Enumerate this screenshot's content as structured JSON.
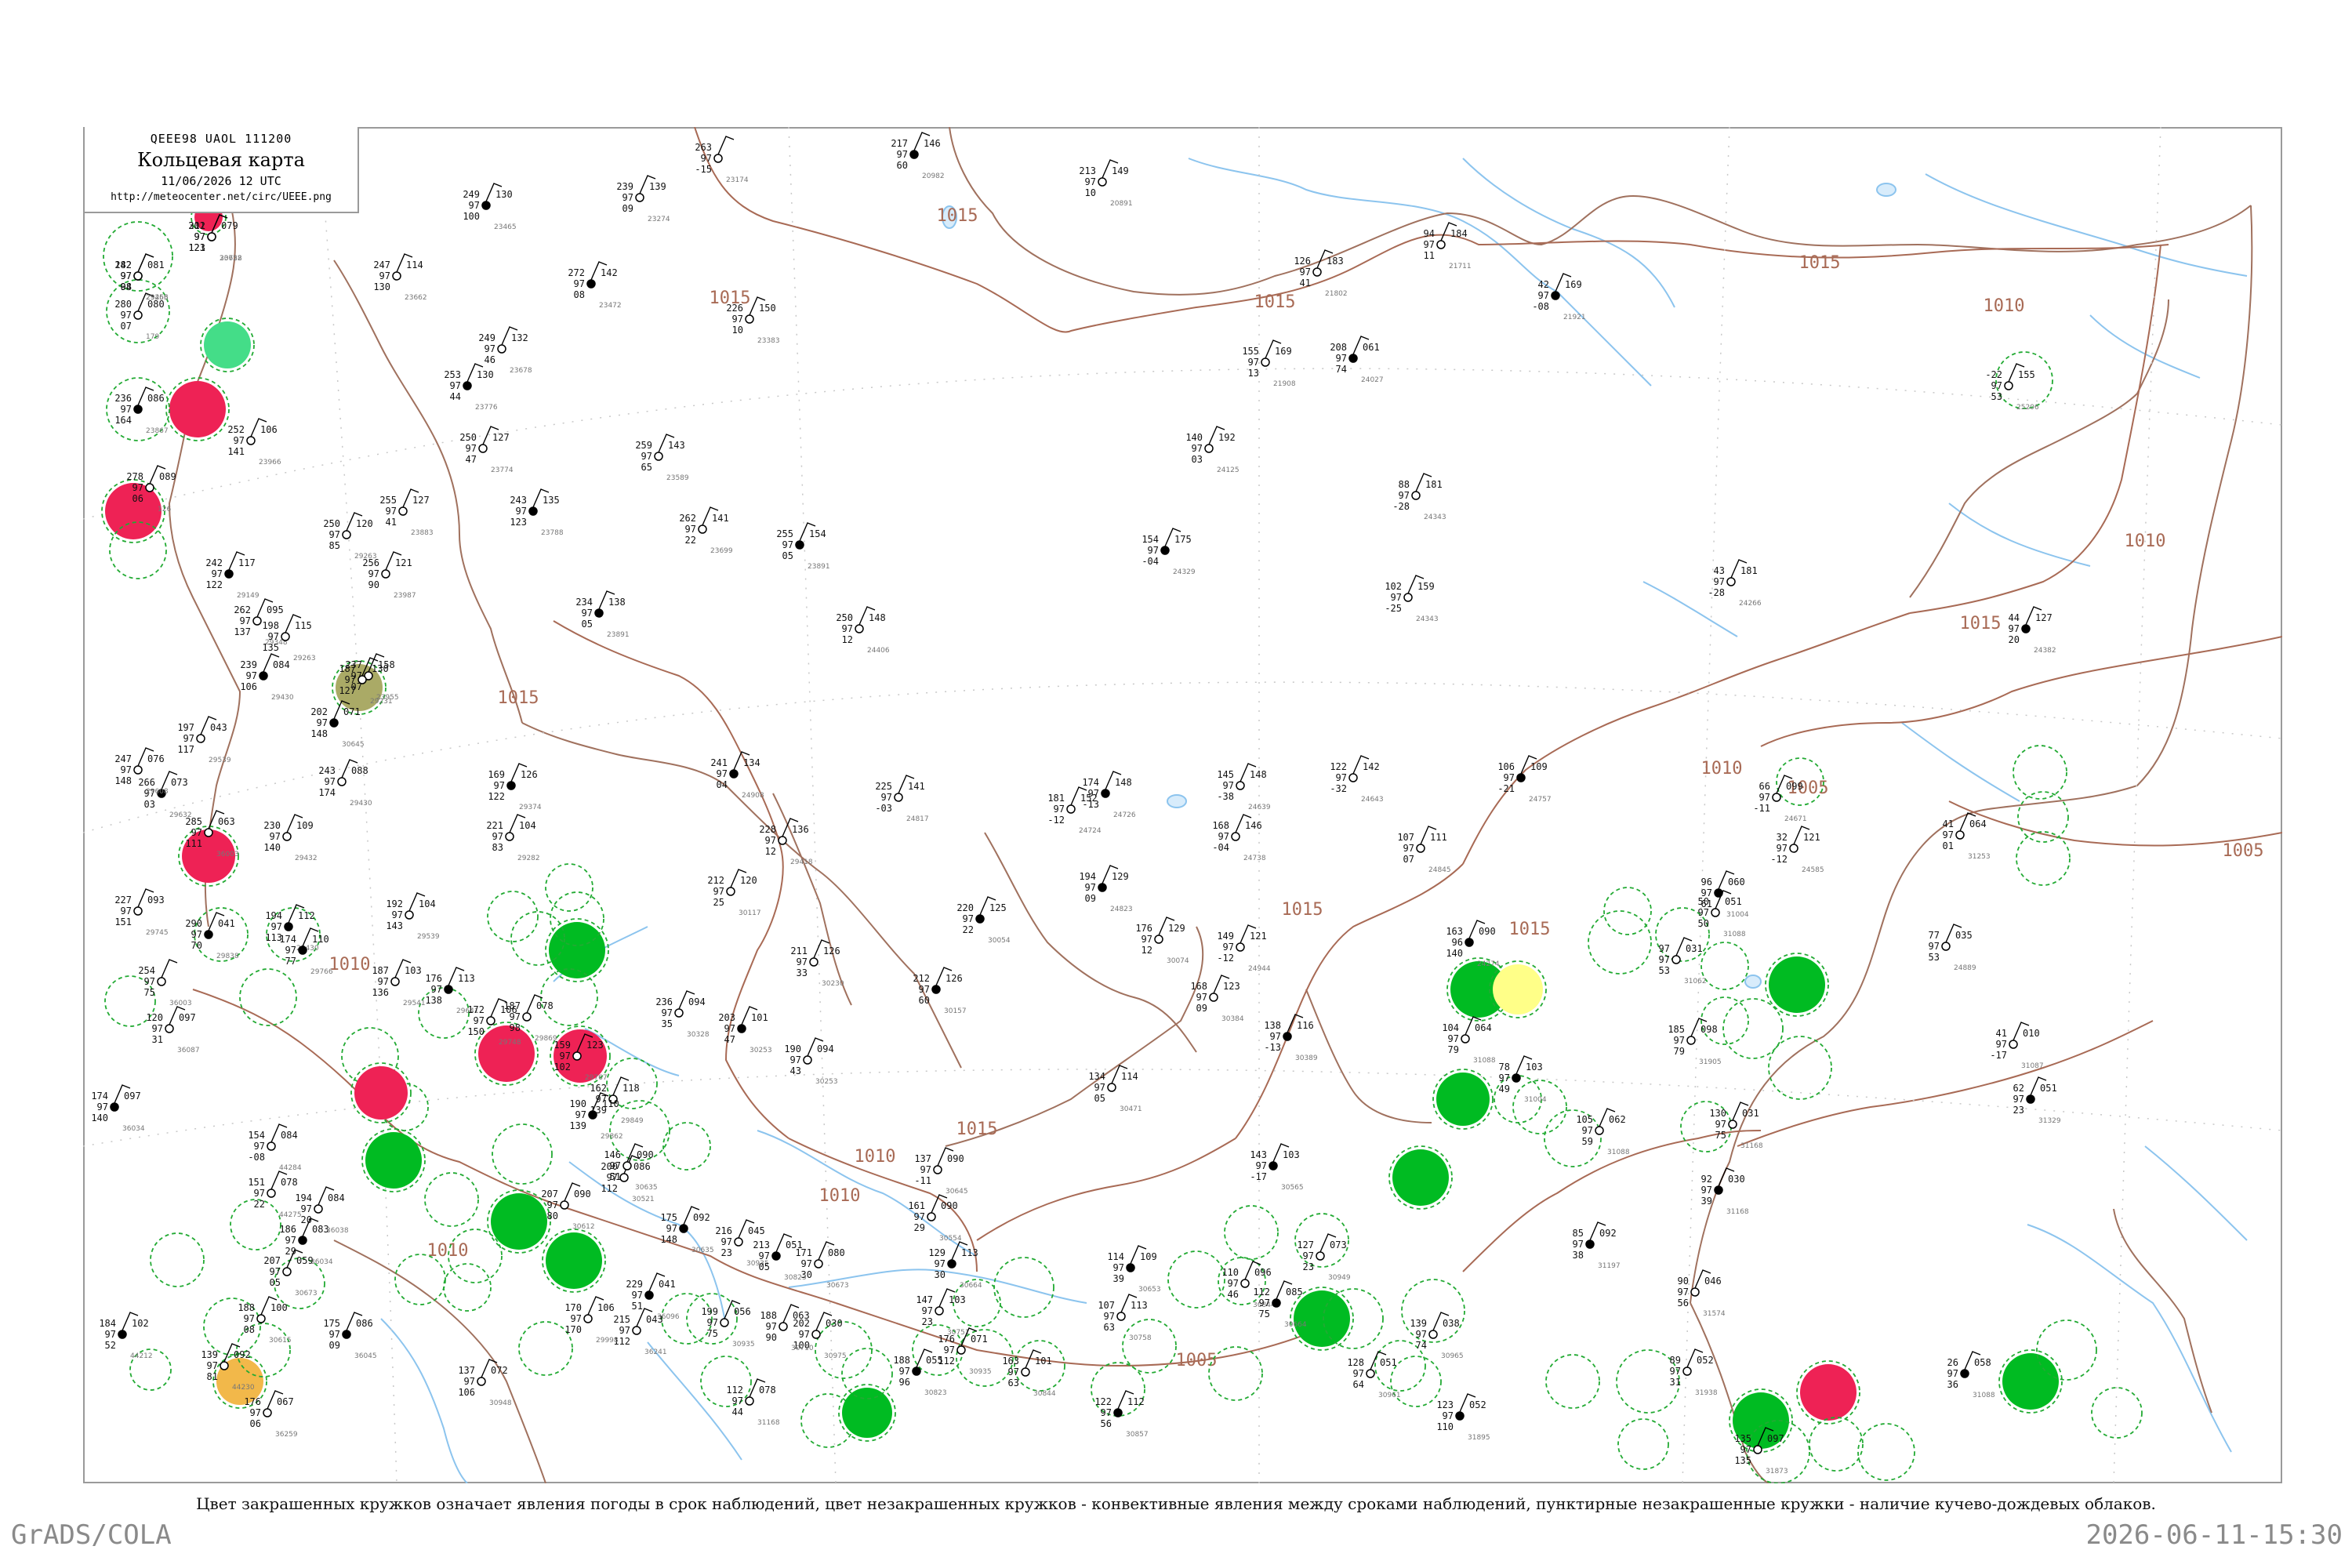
{
  "header": {
    "code": "QEEE98  UAOL  111200",
    "title": "Кольцевая карта",
    "date": "11/06/2026 12 UTC",
    "url": "http://meteocenter.net/circ/UEEE.png"
  },
  "isobar_labels": [
    "1015",
    "1015",
    "1015",
    "1015",
    "1015",
    "1015",
    "1015",
    "1015",
    "1015",
    "1010",
    "1010",
    "1010",
    "1010",
    "1010",
    "1010",
    "1010",
    "1005",
    "1005",
    "1005"
  ],
  "stations": [
    {
      "t": "301",
      "p": "079",
      "d": "97",
      "tt": "121",
      "id": "23758"
    },
    {
      "t": "242",
      "p": "081",
      "d": "97",
      "tt": "04",
      "id": "23456"
    },
    {
      "t": "280",
      "p": "080",
      "d": "97",
      "tt": "07",
      "id": "179"
    },
    {
      "t": "236",
      "p": "086",
      "d": "97",
      "tt": "164",
      "id": "23867"
    },
    {
      "t": "278",
      "p": "089",
      "d": "97",
      "tt": "06",
      "id": "126"
    },
    {
      "t": "252",
      "p": "106",
      "d": "97",
      "tt": "141",
      "id": "23966"
    },
    {
      "t": "249",
      "p": "130",
      "d": "97",
      "tt": "100",
      "id": "23465"
    },
    {
      "t": "239",
      "p": "139",
      "d": "97",
      "tt": "09",
      "id": "23274"
    },
    {
      "t": "263",
      "p": "",
      "d": "97",
      "tt": "-15",
      "id": "23174"
    },
    {
      "t": "217",
      "p": "146",
      "d": "97",
      "tt": "60",
      "id": "20982"
    },
    {
      "t": "213",
      "p": "149",
      "d": "97",
      "tt": "10",
      "id": "20891"
    },
    {
      "t": "247",
      "p": "114",
      "d": "97",
      "tt": "130",
      "id": "23662"
    },
    {
      "t": "272",
      "p": "142",
      "d": "97",
      "tt": "08",
      "id": "23472"
    },
    {
      "t": "226",
      "p": "150",
      "d": "97",
      "tt": "10",
      "id": "23383"
    },
    {
      "t": "249",
      "p": "132",
      "d": "97",
      "tt": "46",
      "id": "23678"
    },
    {
      "t": "253",
      "p": "130",
      "d": "97",
      "tt": "44",
      "id": "23776"
    },
    {
      "t": "250",
      "p": "127",
      "d": "97",
      "tt": "47",
      "id": "23774"
    },
    {
      "t": "255",
      "p": "127",
      "d": "97",
      "tt": "41",
      "id": "23883"
    },
    {
      "t": "243",
      "p": "135",
      "d": "97",
      "tt": "123",
      "id": "23788"
    },
    {
      "t": "259",
      "p": "143",
      "d": "97",
      "tt": "65",
      "id": "23589"
    },
    {
      "t": "262",
      "p": "141",
      "d": "97",
      "tt": "22",
      "id": "23699"
    },
    {
      "t": "255",
      "p": "154",
      "d": "97",
      "tt": "05",
      "id": "23891"
    },
    {
      "t": "250",
      "p": "120",
      "d": "97",
      "tt": "85",
      "id": "29263"
    },
    {
      "t": "256",
      "p": "121",
      "d": "97",
      "tt": "90",
      "id": "23987"
    },
    {
      "t": "242",
      "p": "117",
      "d": "97",
      "tt": "122",
      "id": "29149"
    },
    {
      "t": "262",
      "p": "095",
      "d": "97",
      "tt": "137",
      "id": "29348"
    },
    {
      "t": "198",
      "p": "115",
      "d": "97",
      "tt": "135",
      "id": "29263"
    },
    {
      "t": "234",
      "p": "138",
      "d": "97",
      "tt": "05",
      "id": "23891"
    },
    {
      "t": "250",
      "p": "148",
      "d": "97",
      "tt": "12",
      "id": "24406"
    },
    {
      "t": "237",
      "p": "158",
      "d": "97",
      "tt": "07",
      "id": "23955"
    },
    {
      "t": "241",
      "p": "134",
      "d": "97",
      "tt": "04",
      "id": "24908"
    },
    {
      "t": "225",
      "p": "141",
      "d": "97",
      "tt": "-03",
      "id": "24817"
    },
    {
      "t": "181",
      "p": "152",
      "d": "97",
      "tt": "-12",
      "id": "24724"
    },
    {
      "t": "174",
      "p": "148",
      "d": "97",
      "tt": "-13",
      "id": "24726"
    },
    {
      "t": "145",
      "p": "148",
      "d": "97",
      "tt": "-38",
      "id": "24639"
    },
    {
      "t": "122",
      "p": "142",
      "d": "97",
      "tt": "-32",
      "id": "24643"
    },
    {
      "t": "106",
      "p": "109",
      "d": "97",
      "tt": "-21",
      "id": "24757"
    },
    {
      "t": "126",
      "p": "183",
      "d": "97",
      "tt": "41",
      "id": "21802"
    },
    {
      "t": "94",
      "p": "184",
      "d": "97",
      "tt": "11",
      "id": "21711"
    },
    {
      "t": "42",
      "p": "169",
      "d": "97",
      "tt": "-08",
      "id": "21921"
    },
    {
      "t": "-22",
      "p": "155",
      "d": "97",
      "tt": "53",
      "id": "25206"
    },
    {
      "t": "155",
      "p": "169",
      "d": "97",
      "tt": "13",
      "id": "21908"
    },
    {
      "t": "208",
      "p": "061",
      "d": "97",
      "tt": "74",
      "id": "24027"
    },
    {
      "t": "140",
      "p": "192",
      "d": "97",
      "tt": "03",
      "id": "24125"
    },
    {
      "t": "88",
      "p": "181",
      "d": "97",
      "tt": "-28",
      "id": "24343"
    },
    {
      "t": "154",
      "p": "175",
      "d": "97",
      "tt": "-04",
      "id": "24329"
    },
    {
      "t": "102",
      "p": "159",
      "d": "97",
      "tt": "-25",
      "id": "24343"
    },
    {
      "t": "43",
      "p": "181",
      "d": "97",
      "tt": "-28",
      "id": "24266"
    },
    {
      "t": "44",
      "p": "127",
      "d": "97",
      "tt": "20",
      "id": "24382"
    },
    {
      "t": "187",
      "p": "130",
      "d": "97",
      "tt": "127",
      "id": "29231"
    },
    {
      "t": "221",
      "p": "104",
      "d": "97",
      "tt": "83",
      "id": "29282"
    },
    {
      "t": "169",
      "p": "126",
      "d": "97",
      "tt": "122",
      "id": "29374"
    },
    {
      "t": "228",
      "p": "136",
      "d": "97",
      "tt": "12",
      "id": "29418"
    },
    {
      "t": "212",
      "p": "120",
      "d": "97",
      "tt": "25",
      "id": "30117"
    },
    {
      "t": "194",
      "p": "129",
      "d": "97",
      "tt": "09",
      "id": "24823"
    },
    {
      "t": "168",
      "p": "146",
      "d": "97",
      "tt": "-04",
      "id": "24738"
    },
    {
      "t": "107",
      "p": "111",
      "d": "97",
      "tt": "07",
      "id": "24845"
    },
    {
      "t": "163",
      "p": "090",
      "d": "96",
      "tt": "140",
      "id": "24274"
    },
    {
      "t": "66",
      "p": "099",
      "d": "97",
      "tt": "-11",
      "id": "24671"
    },
    {
      "t": "32",
      "p": "121",
      "d": "97",
      "tt": "-12",
      "id": "24585"
    },
    {
      "t": "96",
      "p": "060",
      "d": "97",
      "tt": "61",
      "id": "31004"
    },
    {
      "t": "50",
      "p": "051",
      "d": "97",
      "tt": "50",
      "id": "31088"
    },
    {
      "t": "77",
      "p": "035",
      "d": "97",
      "tt": "53",
      "id": "24889"
    },
    {
      "t": "220",
      "p": "125",
      "d": "97",
      "tt": "22",
      "id": "30054"
    },
    {
      "t": "176",
      "p": "129",
      "d": "97",
      "tt": "12",
      "id": "30074"
    },
    {
      "t": "149",
      "p": "121",
      "d": "97",
      "tt": "-12",
      "id": "24944"
    },
    {
      "t": "212",
      "p": "126",
      "d": "97",
      "tt": "60",
      "id": "30157"
    },
    {
      "t": "211",
      "p": "126",
      "d": "97",
      "tt": "33",
      "id": "30230"
    },
    {
      "t": "236",
      "p": "094",
      "d": "97",
      "tt": "35",
      "id": "30328"
    },
    {
      "t": "203",
      "p": "101",
      "d": "97",
      "tt": "47",
      "id": "30253"
    },
    {
      "t": "190",
      "p": "094",
      "d": "97",
      "tt": "43",
      "id": "30253"
    },
    {
      "t": "168",
      "p": "123",
      "d": "97",
      "tt": "09",
      "id": "30384"
    },
    {
      "t": "138",
      "p": "116",
      "d": "97",
      "tt": "-13",
      "id": "30389"
    },
    {
      "t": "137",
      "p": "090",
      "d": "97",
      "tt": "-11",
      "id": "30645"
    },
    {
      "t": "161",
      "p": "090",
      "d": "97",
      "tt": "29",
      "id": "30554"
    },
    {
      "t": "143",
      "p": "103",
      "d": "97",
      "tt": "-17",
      "id": "30565"
    },
    {
      "t": "134",
      "p": "114",
      "d": "97",
      "tt": "05",
      "id": "30471"
    },
    {
      "t": "171",
      "p": "080",
      "d": "97",
      "tt": "30",
      "id": "30673"
    },
    {
      "t": "129",
      "p": "113",
      "d": "97",
      "tt": "30",
      "id": "30664"
    },
    {
      "t": "147",
      "p": "103",
      "d": "97",
      "tt": "23",
      "id": "30751"
    },
    {
      "t": "110",
      "p": "096",
      "d": "97",
      "tt": "46",
      "id": "30844"
    },
    {
      "t": "114",
      "p": "109",
      "d": "97",
      "tt": "39",
      "id": "30653"
    },
    {
      "t": "107",
      "p": "113",
      "d": "97",
      "tt": "63",
      "id": "30758"
    },
    {
      "t": "127",
      "p": "073",
      "d": "97",
      "tt": "23",
      "id": "30949"
    },
    {
      "t": "112",
      "p": "085",
      "d": "97",
      "tt": "75",
      "id": "30664"
    },
    {
      "t": "128",
      "p": "051",
      "d": "97",
      "tt": "64",
      "id": "30961"
    },
    {
      "t": "139",
      "p": "038",
      "d": "97",
      "tt": "74",
      "id": "30965"
    },
    {
      "t": "85",
      "p": "092",
      "d": "97",
      "tt": "38",
      "id": "31197"
    },
    {
      "t": "105",
      "p": "062",
      "d": "97",
      "tt": "59",
      "id": "31088"
    },
    {
      "t": "130",
      "p": "031",
      "d": "97",
      "tt": "75",
      "id": "31168"
    },
    {
      "t": "92",
      "p": "030",
      "d": "97",
      "tt": "39",
      "id": "31168"
    },
    {
      "t": "90",
      "p": "046",
      "d": "97",
      "tt": "56",
      "id": "31574"
    },
    {
      "t": "97",
      "p": "031",
      "d": "97",
      "tt": "53",
      "id": "31062"
    },
    {
      "t": "62",
      "p": "051",
      "d": "97",
      "tt": "23",
      "id": "31329"
    },
    {
      "t": "41",
      "p": "010",
      "d": "97",
      "tt": "-17",
      "id": "31087"
    },
    {
      "t": "41",
      "p": "064",
      "d": "97",
      "tt": "01",
      "id": "31253"
    },
    {
      "t": "26",
      "p": "058",
      "d": "97",
      "tt": "36",
      "id": "31088"
    },
    {
      "t": "89",
      "p": "052",
      "d": "97",
      "tt": "31",
      "id": "31938"
    },
    {
      "t": "135",
      "p": "097",
      "d": "97",
      "tt": "135",
      "id": "31873"
    },
    {
      "t": "123",
      "p": "052",
      "d": "97",
      "tt": "110",
      "id": "31895"
    },
    {
      "t": "185",
      "p": "098",
      "d": "97",
      "tt": "79",
      "id": "31905"
    },
    {
      "t": "104",
      "p": "064",
      "d": "97",
      "tt": "79",
      "id": "31088"
    },
    {
      "t": "78",
      "p": "103",
      "d": "97",
      "tt": "49",
      "id": "31004"
    },
    {
      "t": "112",
      "p": "078",
      "d": "97",
      "tt": "44",
      "id": "31168"
    },
    {
      "t": "202",
      "p": "030",
      "d": "97",
      "tt": "100",
      "id": "30975"
    },
    {
      "t": "188",
      "p": "055",
      "d": "97",
      "tt": "96",
      "id": "30823"
    },
    {
      "t": "176",
      "p": "071",
      "d": "97",
      "tt": "112",
      "id": "30935"
    },
    {
      "t": "163",
      "p": "101",
      "d": "97",
      "tt": "63",
      "id": "30844"
    },
    {
      "t": "122",
      "p": "112",
      "d": "97",
      "tt": "56",
      "id": "30857"
    },
    {
      "t": "137",
      "p": "072",
      "d": "97",
      "tt": "106",
      "id": "30948"
    },
    {
      "t": "215",
      "p": "043",
      "d": "97",
      "tt": "112",
      "id": "36241"
    },
    {
      "t": "229",
      "p": "041",
      "d": "97",
      "tt": "51",
      "id": "36096"
    },
    {
      "t": "199",
      "p": "056",
      "d": "97",
      "tt": "75",
      "id": "30935"
    },
    {
      "t": "216",
      "p": "045",
      "d": "97",
      "tt": "23",
      "id": "30935"
    },
    {
      "t": "213",
      "p": "051",
      "d": "97",
      "tt": "05",
      "id": "30823"
    },
    {
      "t": "188",
      "p": "063",
      "d": "97",
      "tt": "90",
      "id": "30710"
    },
    {
      "t": "207",
      "p": "059",
      "d": "97",
      "tt": "05",
      "id": "30673"
    },
    {
      "t": "186",
      "p": "083",
      "d": "97",
      "tt": "29",
      "id": "36034"
    },
    {
      "t": "194",
      "p": "084",
      "d": "97",
      "tt": "20",
      "id": "36038"
    },
    {
      "t": "188",
      "p": "100",
      "d": "97",
      "tt": "08",
      "id": "30615"
    },
    {
      "t": "175",
      "p": "086",
      "d": "97",
      "tt": "09",
      "id": "36045"
    },
    {
      "t": "176",
      "p": "067",
      "d": "97",
      "tt": "06",
      "id": "36259"
    },
    {
      "t": "139",
      "p": "092",
      "d": "97",
      "tt": "81",
      "id": "44230"
    },
    {
      "t": "184",
      "p": "102",
      "d": "97",
      "tt": "52",
      "id": "44212"
    },
    {
      "t": "154",
      "p": "084",
      "d": "97",
      "tt": "-08",
      "id": "44284"
    },
    {
      "t": "151",
      "p": "078",
      "d": "97",
      "tt": "22",
      "id": "44275"
    },
    {
      "t": "174",
      "p": "097",
      "d": "97",
      "tt": "140",
      "id": "36034"
    },
    {
      "t": "120",
      "p": "097",
      "d": "97",
      "tt": "31",
      "id": "36087"
    },
    {
      "t": "254",
      "p": "",
      "d": "97",
      "tt": "75",
      "id": "36003"
    },
    {
      "t": "290",
      "p": "041",
      "d": "97",
      "tt": "70",
      "id": "29838"
    },
    {
      "t": "285",
      "p": "063",
      "d": "97",
      "tt": "111",
      "id": "36003"
    },
    {
      "t": "227",
      "p": "093",
      "d": "97",
      "tt": "151",
      "id": "29745"
    },
    {
      "t": "266",
      "p": "073",
      "d": "97",
      "tt": "03",
      "id": "29632"
    },
    {
      "t": "247",
      "p": "076",
      "d": "97",
      "tt": "148",
      "id": "29608"
    },
    {
      "t": "197",
      "p": "043",
      "d": "97",
      "tt": "117",
      "id": "29539"
    },
    {
      "t": "239",
      "p": "084",
      "d": "97",
      "tt": "106",
      "id": "29430"
    },
    {
      "t": "243",
      "p": "088",
      "d": "97",
      "tt": "174",
      "id": "29430"
    },
    {
      "t": "230",
      "p": "109",
      "d": "97",
      "tt": "140",
      "id": "29432"
    },
    {
      "t": "194",
      "p": "112",
      "d": "97",
      "tt": "113",
      "id": "29430"
    },
    {
      "t": "192",
      "p": "104",
      "d": "97",
      "tt": "143",
      "id": "29539"
    },
    {
      "t": "187",
      "p": "103",
      "d": "97",
      "tt": "136",
      "id": "29541"
    },
    {
      "t": "176",
      "p": "113",
      "d": "97",
      "tt": "138",
      "id": "29641"
    },
    {
      "t": "172",
      "p": "106",
      "d": "97",
      "tt": "150",
      "id": "29748"
    },
    {
      "t": "187",
      "p": "078",
      "d": "97",
      "tt": "98",
      "id": "29869"
    },
    {
      "t": "174",
      "p": "110",
      "d": "97",
      "tt": "77",
      "id": "29766"
    },
    {
      "t": "159",
      "p": "123",
      "d": "97",
      "tt": "102",
      "id": "29767"
    },
    {
      "t": "162",
      "p": "118",
      "d": "97",
      "tt": "139",
      "id": "29849"
    },
    {
      "t": "190",
      "p": "110",
      "d": "97",
      "tt": "139",
      "id": "29862"
    },
    {
      "t": "207",
      "p": "090",
      "d": "97",
      "tt": "80",
      "id": "30612"
    },
    {
      "t": "200",
      "p": "086",
      "d": "97",
      "tt": "112",
      "id": "30521"
    },
    {
      "t": "175",
      "p": "092",
      "d": "97",
      "tt": "148",
      "id": "30635"
    },
    {
      "t": "170",
      "p": "106",
      "d": "97",
      "tt": "170",
      "id": "29998"
    },
    {
      "t": "146",
      "p": "090",
      "d": "97",
      "tt": "51",
      "id": "30635"
    },
    {
      "t": "202",
      "p": "071",
      "d": "97",
      "tt": "148",
      "id": "30645"
    },
    {
      "t": "212",
      "p": "",
      "d": "97",
      "tt": "123",
      "id": "30622"
    },
    {
      "t": "182",
      "p": "",
      "d": "97",
      "tt": "98",
      "id": "29263"
    }
  ],
  "caption": "Цвет закрашенных кружков означает явления погоды в срок наблюдений, цвет незакрашенных кружков - конвективные явления между сроками наблюдений, пунктирные незакрашенные кружки - наличие кучево-дождевых облаков.",
  "footer": {
    "left": "GrADS/COLA",
    "right": "2026-06-11-15:30"
  },
  "colors": {
    "isobar": "#a86a55",
    "river": "#8cc4ee",
    "frame": "#9a9a9a",
    "thunder_fill": "#00bb22",
    "shower_fill": "#ee2255",
    "cb_ring": "#22aa33",
    "haze_fill": "#aaaa66",
    "fog_fill": "#ffff88",
    "dust_fill": "#f2b84a",
    "drizzle_fill": "#44dd88"
  }
}
